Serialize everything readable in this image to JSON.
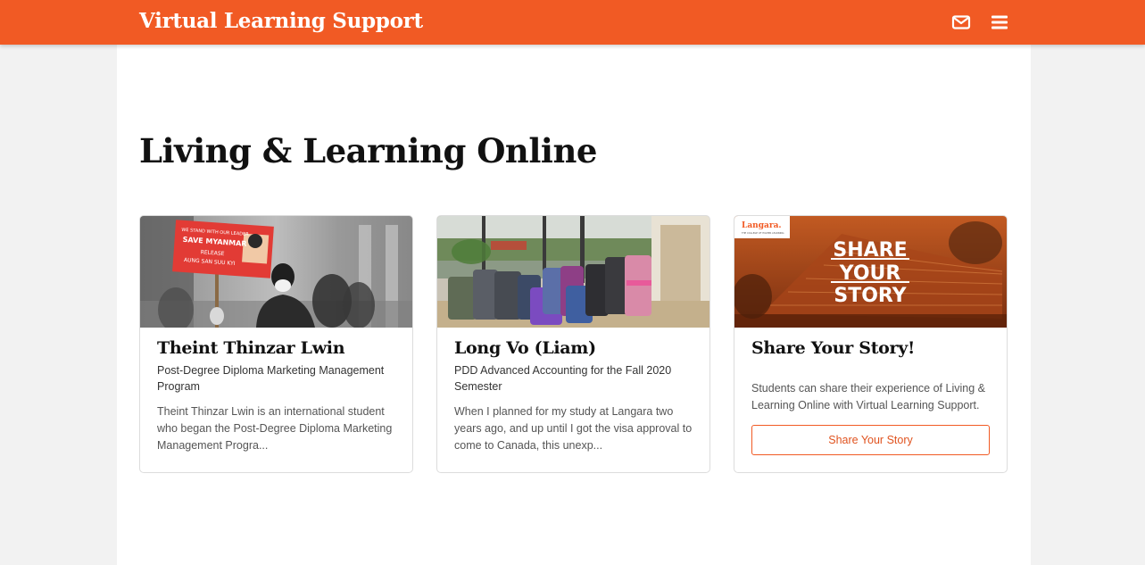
{
  "header": {
    "brand": "Virtual Learning Support",
    "mail_icon": "envelope-icon",
    "menu_icon": "hamburger-menu-icon",
    "bar_color": "#f15a24"
  },
  "page": {
    "title": "Living & Learning Online"
  },
  "cards": [
    {
      "name": "Theint Thinzar Lwin",
      "program": "Post-Degree Diploma Marketing Management Program",
      "excerpt": "Theint Thinzar Lwin is an international student who began the Post-Degree Diploma Marketing Management Progra...",
      "image_sign": {
        "line1": "WE STAND WITH OUR LEADER",
        "line2": "SAVE MYANMAR",
        "line3": "RELEASE",
        "line4": "AUNG SAN SUU KYI"
      }
    },
    {
      "name": "Long Vo (Liam)",
      "program": "PDD Advanced Accounting for the Fall 2020 Semester",
      "excerpt": "When I planned for my study at Langara two years ago, and up until I got the visa approval to come to Canada, this unexp..."
    },
    {
      "name": "Share Your Story!",
      "description": "Students can share their experience of Living & Learning Online with Virtual Learning Support.",
      "button_label": "Share Your Story",
      "image_logo": "Langara.",
      "image_logo_sub": "THE COLLEGE OF HIGHER LEARNING",
      "image_text": [
        "SHARE",
        "YOUR",
        "STORY"
      ]
    }
  ]
}
